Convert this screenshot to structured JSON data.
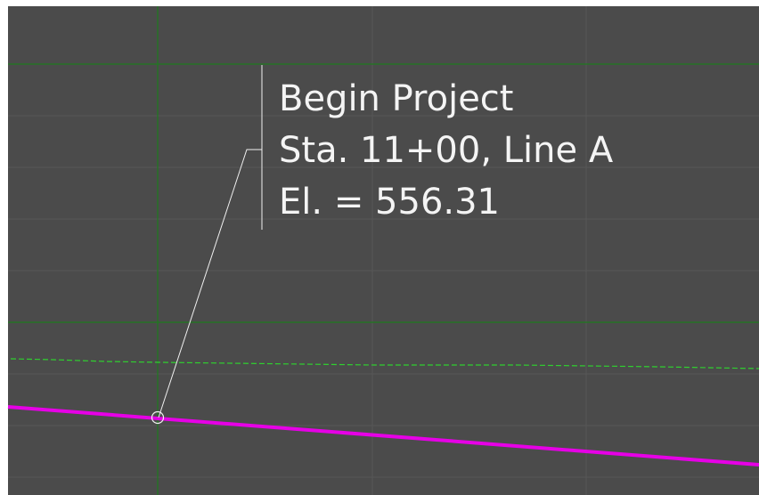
{
  "annotation": {
    "line1": "Begin Project",
    "line2": "Sta. 11+00, Line A",
    "line3": "El. = 556.31"
  },
  "colors": {
    "background": "#4b4b4b",
    "grid_major": "#1f7a1f",
    "grid_minor": "#565656",
    "profile_line": "#e600e6",
    "ground_line": "#2fd02f",
    "leader": "#f0f0f0",
    "text": "#f4f4f4"
  }
}
